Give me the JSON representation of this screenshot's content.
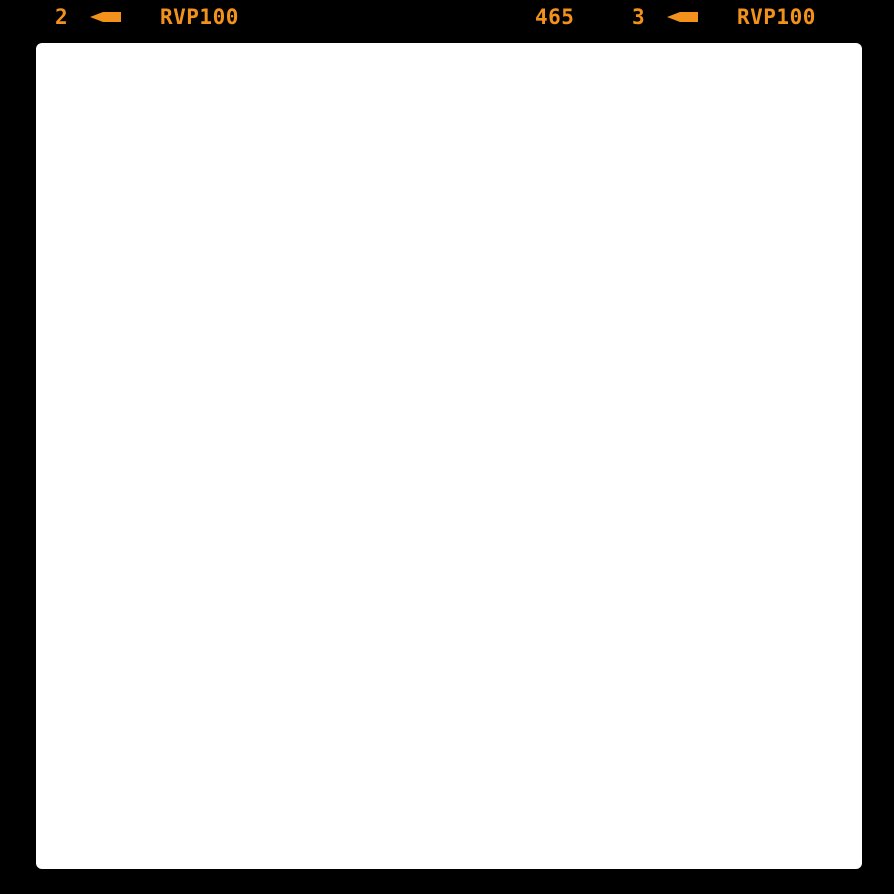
{
  "film_edge": {
    "frame_1_number": "2",
    "film_code_1": "RVP100",
    "edge_number": "465",
    "frame_2_number": "3",
    "film_code_2": "RVP100",
    "arrow_icon": "left-pointing-arrow-icon",
    "marking_color": "#f2921c"
  },
  "frame": {
    "border_color": "#000000",
    "image_color": "#ffffff"
  }
}
